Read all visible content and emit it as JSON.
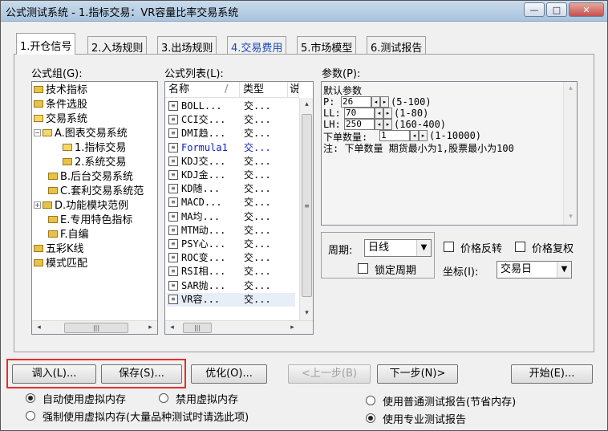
{
  "window": {
    "title": "公式测试系统 - 1.指标交易：VR容量比率交易系统",
    "btn_min": "—",
    "btn_max": "□",
    "btn_close": "✕"
  },
  "tabs": [
    {
      "label": "1.开仓信号",
      "active": true
    },
    {
      "label": "2.入场规则"
    },
    {
      "label": "3.出场规则"
    },
    {
      "label": "4.交易费用",
      "color": "#1a49b8"
    },
    {
      "label": "5.市场模型"
    },
    {
      "label": "6.测试报告"
    }
  ],
  "formula_group": {
    "label": "公式组(G):",
    "items": [
      {
        "text": "技术指标"
      },
      {
        "text": "条件选股"
      },
      {
        "text": "交易系统"
      },
      {
        "text": "A.图表交易系统"
      },
      {
        "text": "1.指标交易"
      },
      {
        "text": "2.系统交易"
      },
      {
        "text": "B.后台交易系统"
      },
      {
        "text": "C.套利交易系统范"
      },
      {
        "text": "D.功能模块范例"
      },
      {
        "text": "E.专用特色指标"
      },
      {
        "text": "F.自编"
      },
      {
        "text": "五彩K线"
      },
      {
        "text": "模式匹配"
      }
    ],
    "tree_plus": "+",
    "tree_minus": "−"
  },
  "formula_list": {
    "label": "公式列表(L):",
    "col_name": "名称",
    "col_sort": "/",
    "col_type": "类型",
    "col_more": "说",
    "doc_glyph": "≡",
    "rows": [
      {
        "name": "BOLL...",
        "type": "交..."
      },
      {
        "name": "CCI交...",
        "type": "交..."
      },
      {
        "name": "DMI趋...",
        "type": "交..."
      },
      {
        "name": "Formula1",
        "type": "交...",
        "color": "#1020c0"
      },
      {
        "name": "KDJ交...",
        "type": "交..."
      },
      {
        "name": "KDJ金...",
        "type": "交..."
      },
      {
        "name": "KD随...",
        "type": "交..."
      },
      {
        "name": "MACD...",
        "type": "交..."
      },
      {
        "name": "MA均...",
        "type": "交..."
      },
      {
        "name": "MTM动...",
        "type": "交..."
      },
      {
        "name": "PSY心...",
        "type": "交..."
      },
      {
        "name": "ROC变...",
        "type": "交..."
      },
      {
        "name": "RSI相...",
        "type": "交..."
      },
      {
        "name": "SAR抛...",
        "type": "交..."
      },
      {
        "name": "VR容...",
        "type": "交...",
        "selected": true
      }
    ]
  },
  "scroll": {
    "left": "◂",
    "right": "▸",
    "up": "▴",
    "down": "▾",
    "grip_h": "|||",
    "grip_v": "≡"
  },
  "params": {
    "label": "参数(P):",
    "heading": "默认参数",
    "p_label": "P:",
    "p_value": "26",
    "p_range": "(5-100)",
    "ll_label": "LL:",
    "ll_value": "70",
    "ll_range": "(1-80)",
    "lh_label": "LH:",
    "lh_value": "250",
    "lh_range": "(160-400)",
    "qty_label": "下单数量:",
    "qty_value": "1",
    "qty_range": "(1-10000)",
    "note": "注: 下单数量 期货最小为1,股票最小为100",
    "spin_left": "◂",
    "spin_right": "▸"
  },
  "period": {
    "label": "周期:",
    "value": "日线",
    "lock_label": "锁定周期",
    "dropdown_glyph": "▼"
  },
  "price_reverse": "价格反转",
  "price_restore": "价格复权",
  "axis": {
    "label": "坐标(I):",
    "value": "交易日"
  },
  "buttons": {
    "load": "调入(L)...",
    "save": "保存(S)...",
    "optimize": "优化(O)...",
    "prev": "<上一步(B)",
    "next": "下一步(N)>",
    "start": "开始(E)..."
  },
  "options": {
    "auto_vm": "自动使用虚拟内存",
    "no_vm": "禁用虚拟内存",
    "force_vm": "强制使用虚拟内存(大量品种测试时请选此项)",
    "normal_report": "使用普通测试报告(节省内存)",
    "pro_report": "使用专业测试报告"
  }
}
